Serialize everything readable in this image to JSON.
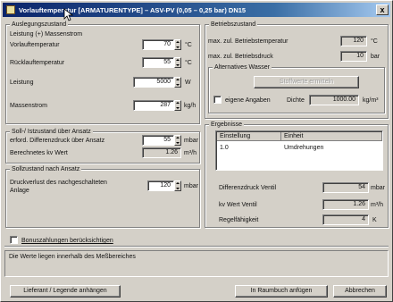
{
  "window": {
    "title": "Vorlauftemperatur [ARMATURENTYPE] – ASV-PV (0,05 – 0,25 bar) DN15",
    "close_label": "x"
  },
  "left": {
    "auslegung": {
      "title": "Auslegungszustand",
      "sub_title": "Leistung (+) Massenstrom",
      "rows": [
        {
          "label": "Vorlauftemperatur",
          "value": "70",
          "unit": "°C"
        },
        {
          "label": "Rücklauftemperatur",
          "value": "55",
          "unit": "°C"
        },
        {
          "label": "Leistung",
          "value": "5000",
          "unit": "W"
        },
        {
          "label": "Massenstrom",
          "value": "287",
          "unit": "kg/h"
        }
      ]
    },
    "soll": {
      "title": "Soll-/ Istzustand über Ansatz",
      "rows": [
        {
          "label": "erford. Differenzdruck über Ansatz",
          "value": "55",
          "unit": "mbar"
        },
        {
          "label": "Berechnetes kv Wert",
          "value": "1.26",
          "unit": "m³/h"
        }
      ]
    },
    "sollzustand": {
      "title": "Sollzustand nach Ansatz",
      "label_line1": "Druckverlust des nachgeschalteten",
      "label_line2": "Anlage",
      "value": "120",
      "unit": "mbar"
    },
    "checkbox_label": "Bonuszahlungen berücksichtigen"
  },
  "right": {
    "betrieb": {
      "title": "Betriebszustand",
      "rows": [
        {
          "label": "max. zul. Betriebstemperatur",
          "value": "120",
          "unit": "°C"
        },
        {
          "label": "max. zul. Betriebsdruck",
          "value": "10",
          "unit": "bar"
        }
      ],
      "sub_title": "Alternatives Wasser",
      "disabled_button": "Stoffwerte ermitteln",
      "checkbox_label": "eigene Angaben",
      "density_label": "Dichte",
      "density_value": "1000.00",
      "density_unit": "kg/m³"
    },
    "ergebnisse": {
      "title": "Ergebnisse",
      "columns": [
        "Einstellung",
        "Einheit"
      ],
      "rows": [
        {
          "setting": "1.0",
          "unit": "Umdrehungen"
        }
      ],
      "results": [
        {
          "label": "Differenzdruck Ventil",
          "value": "54",
          "unit": "mbar"
        },
        {
          "label": "kv Wert Ventil",
          "value": "1.26",
          "unit": "m³/h"
        },
        {
          "label": "Regelfähigkeit",
          "value": "4",
          "unit": "K"
        }
      ]
    }
  },
  "status_text": "Die Werte liegen innerhalb des Meßbereiches",
  "buttons": {
    "left": "Lieferant / Legende anhängen",
    "middle": "In Raumbuch anfügen",
    "cancel": "Abbrechen"
  }
}
